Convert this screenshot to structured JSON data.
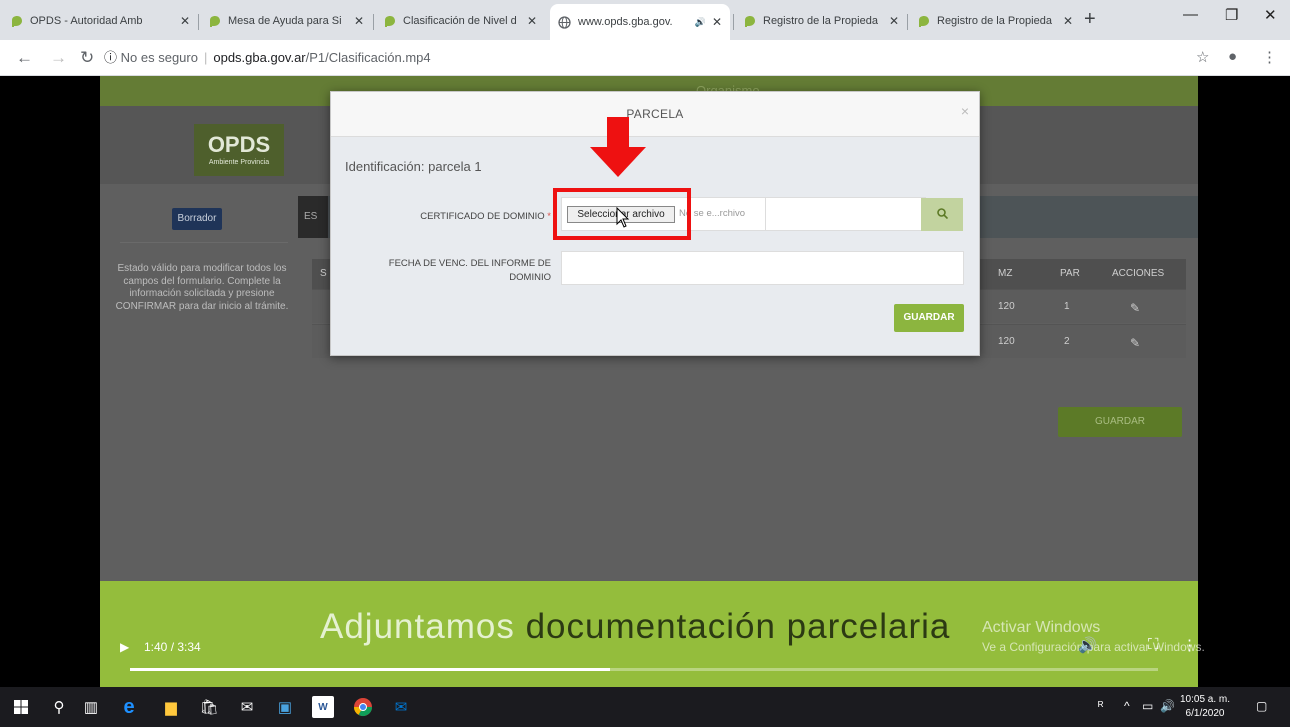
{
  "browser": {
    "tabs": [
      {
        "title": "OPDS - Autoridad Amb",
        "icon": "opds-favicon"
      },
      {
        "title": "Mesa de Ayuda para Si",
        "icon": "opds-favicon"
      },
      {
        "title": "Clasificación de Nivel d",
        "icon": "opds-favicon"
      },
      {
        "title": "www.opds.gba.gov.",
        "icon": "globe-icon",
        "active": true,
        "audio": true
      },
      {
        "title": "Registro de la Propieda",
        "icon": "opds-favicon"
      },
      {
        "title": "Registro de la Propieda",
        "icon": "opds-favicon"
      }
    ],
    "address": {
      "security": "No es seguro",
      "host": "opds.gba.gov.ar",
      "path": "/P1/Clasificación.mp4"
    }
  },
  "site": {
    "top_menu": "Organismo",
    "logo": "OPDS",
    "logo_sub": "Ambiente Provincia",
    "draft_badge": "Borrador",
    "tab_partial": "ES",
    "side_help": "Estado válido para modificar todos los campos del formulario. Complete la información solicitada y presione CONFIRMAR para dar inicio al trámite.",
    "table": {
      "headers": {
        "first": "S",
        "mz": "MZ",
        "par": "PAR",
        "acciones": "ACCIONES"
      },
      "rows": [
        {
          "mz": "120",
          "par": "1"
        },
        {
          "mz": "120",
          "par": "2"
        }
      ]
    },
    "save_label": "GUARDAR"
  },
  "modal": {
    "title": "PARCELA",
    "close": "×",
    "identification": "Identificación: parcela 1",
    "cert_label": "CERTIFICADO DE DOMINIO",
    "required_mark": "*",
    "file_button": "Seleccionar archivo",
    "file_status": "No se e...rchivo",
    "date_label_line1": "FECHA DE VENC. DEL INFORME DE",
    "date_label_line2": "DOMINIO",
    "save_label": "GUARDAR"
  },
  "video": {
    "caption_part1": "Adjuntamos",
    "caption_part2": "documentación parcelaria",
    "time": "1:40 / 3:34",
    "progress": 0.467
  },
  "watermark": {
    "line1": "Activar Windows",
    "line2": "Ve a Configuración para activar Windows."
  },
  "taskbar": {
    "time": "10:05 a. m.",
    "date": "6/1/2020"
  },
  "colors": {
    "accent_green": "#8cb53f",
    "highlight_red": "#ee1111",
    "caption_band": "#94bd3c"
  }
}
